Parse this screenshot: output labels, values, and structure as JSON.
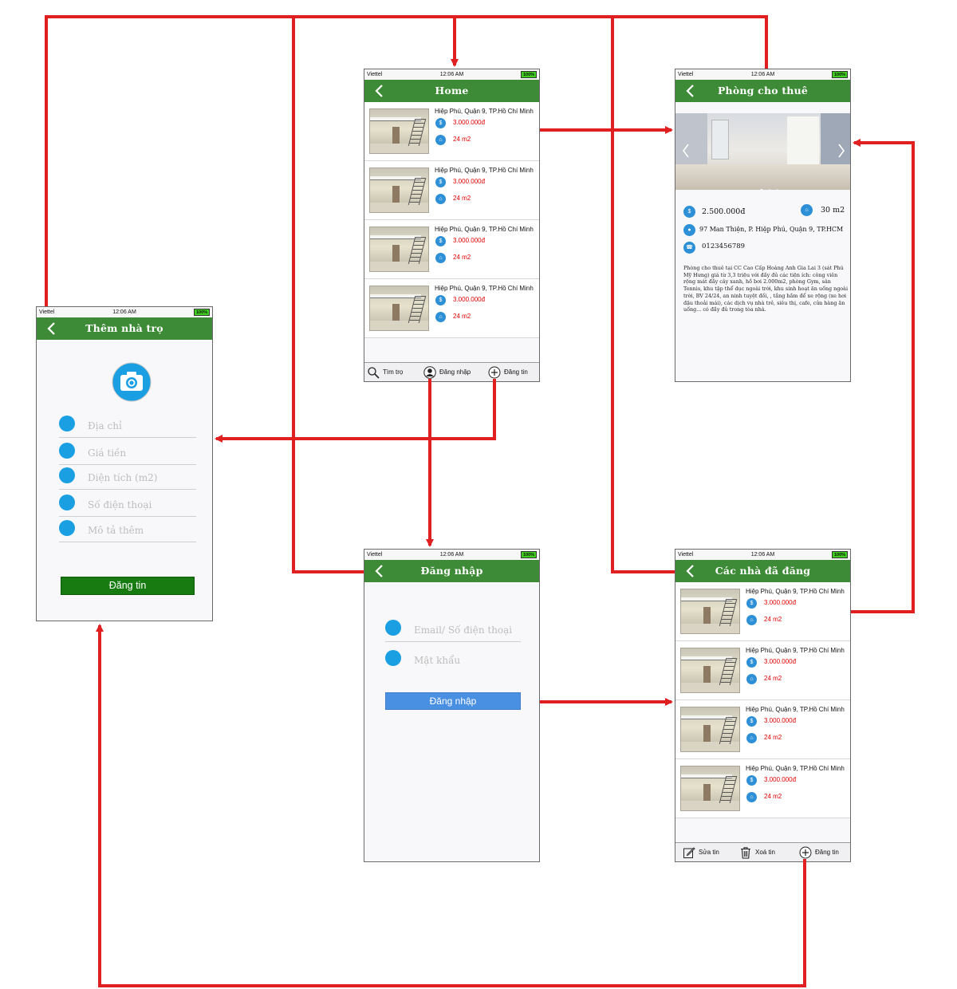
{
  "colors": {
    "nav_green": "#3e8b37",
    "arrow_red": "#e02020",
    "price_red": "#e00000",
    "post_button_green": "#177b12",
    "login_button_blue": "#4a90e2",
    "icon_blue": "#2d8fd6"
  },
  "status_bar": {
    "carrier": "Viettel",
    "time": "12:06 AM",
    "battery": "100%"
  },
  "screens": {
    "home": {
      "title": "Home",
      "listings": [
        {
          "address": "Hiệp Phú, Quận 9, TP.Hồ Chí Minh",
          "price": "3.000.000đ",
          "area": "24 m2"
        },
        {
          "address": "Hiệp Phú, Quận 9, TP.Hồ Chí Minh",
          "price": "3.000.000đ",
          "area": "24 m2"
        },
        {
          "address": "Hiệp Phú, Quận 9, TP.Hồ Chí Minh",
          "price": "3.000.000đ",
          "area": "24 m2"
        },
        {
          "address": "Hiệp Phú, Quận 9, TP.Hồ Chí Minh",
          "price": "3.000.000đ",
          "area": "24 m2"
        }
      ],
      "toolbar": {
        "search": "Tìm trọ",
        "login": "Đăng nhập",
        "post": "Đăng tin"
      }
    },
    "detail": {
      "title": "Phòng cho thuê",
      "price": "2.500.000đ",
      "area": "30 m2",
      "address": "97 Man Thiện, P. Hiệp Phú, Quận 9, TP.HCM",
      "phone": "0123456789",
      "description": "Phòng cho thuê tại CC Cao Cấp Hoàng Anh Gia Lai 3 (sát Phú Mỹ Hưng) giá từ 3,3 triệu với đầy đủ các tiện ích: công viên rộng mát đầy cây xanh, hồ bơi 2.000m2, phòng Gym, sân Tennis, khu tập thể dục ngoài trời, khu sinh hoạt ăn uống ngoài trời, BV 24/24, an ninh tuyệt đối, , tầng hầm để xe rộng (xe hơi đậu thoải mái), các dịch vụ nhà trẻ, siêu thị, cafe, cửa hàng ăn uống... có đầy đủ trong tòa nhà.",
      "carousel_icons": [
        "chevron-left-icon",
        "chevron-right-icon"
      ]
    },
    "add": {
      "title": "Thêm nhà trọ",
      "fields": {
        "address": "Địa chỉ",
        "price": "Giá tiền",
        "area": "Diện tích (m2)",
        "phone": "Số điện thoại",
        "description": "Mô tả thêm"
      },
      "submit": "Đăng tin"
    },
    "login": {
      "title": "Đăng nhập",
      "email_placeholder": "Email/ Số điện thoại",
      "password_placeholder": "Mật khẩu",
      "submit": "Đăng nhập"
    },
    "posted": {
      "title": "Các nhà đã đăng",
      "listings": [
        {
          "address": "Hiệp Phú, Quận 9, TP.Hồ Chí Minh",
          "price": "3.000.000đ",
          "area": "24 m2"
        },
        {
          "address": "Hiệp Phú, Quận 9, TP.Hồ Chí Minh",
          "price": "3.000.000đ",
          "area": "24 m2"
        },
        {
          "address": "Hiệp Phú, Quận 9, TP.Hồ Chí Minh",
          "price": "3.000.000đ",
          "area": "24 m2"
        },
        {
          "address": "Hiệp Phú, Quận 9, TP.Hồ Chí Minh",
          "price": "3.000.000đ",
          "area": "24 m2"
        }
      ],
      "toolbar": {
        "edit": "Sửa tin",
        "delete": "Xoá tin",
        "post": "Đăng tin"
      }
    }
  },
  "flows": [
    {
      "from": "home-listing",
      "to": "detail"
    },
    {
      "from": "home-post",
      "to": "add"
    },
    {
      "from": "home-login",
      "to": "login"
    },
    {
      "from": "login-submit",
      "to": "posted"
    },
    {
      "from": "posted-listing",
      "to": "detail"
    },
    {
      "from": "posted-post",
      "to": "add"
    },
    {
      "from": "add-back",
      "to": "home"
    },
    {
      "from": "detail-back",
      "to": "home"
    },
    {
      "from": "login-back",
      "to": "home"
    },
    {
      "from": "posted-back",
      "to": "home"
    }
  ]
}
